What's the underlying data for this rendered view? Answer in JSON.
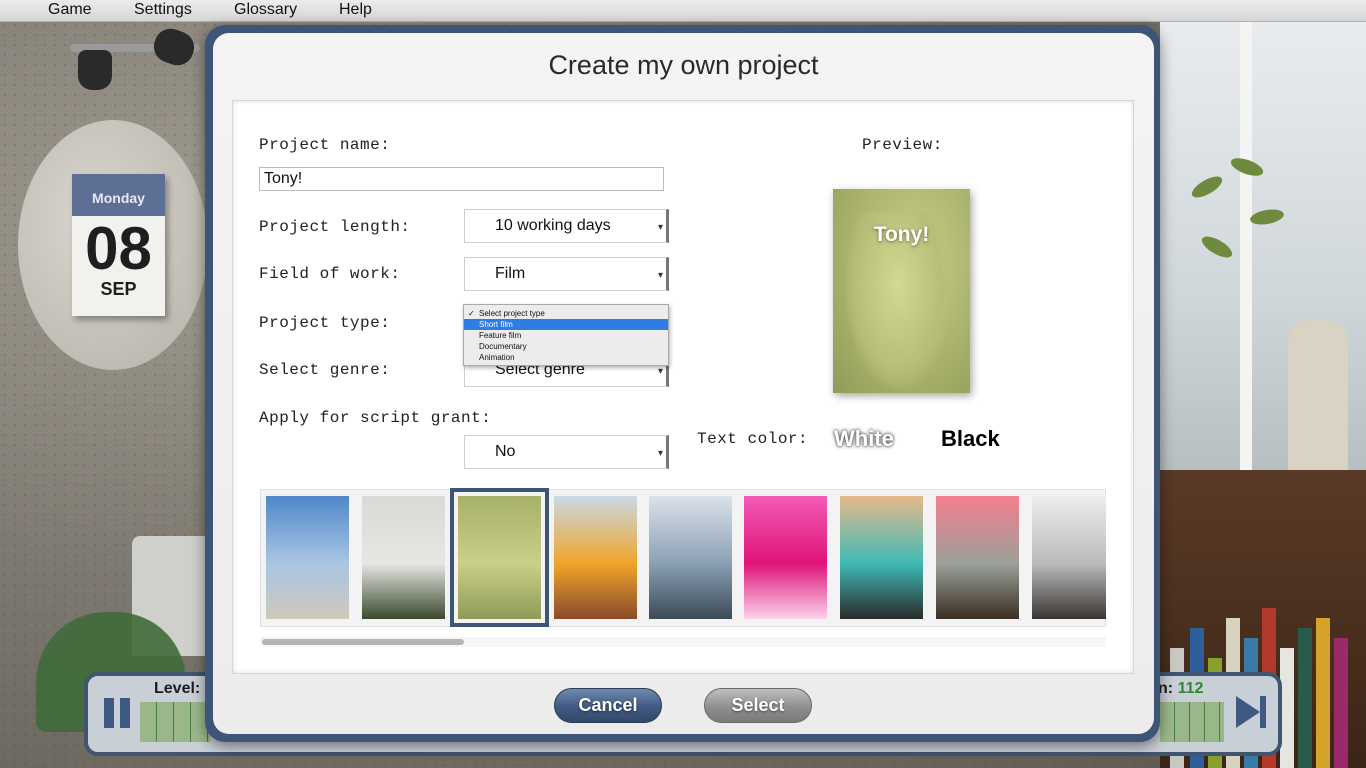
{
  "menu": {
    "items": [
      "Game",
      "Settings",
      "Glossary",
      "Help"
    ]
  },
  "calendar": {
    "weekday": "Monday",
    "day": "08",
    "month": "SEP"
  },
  "gamebar": {
    "level_label": "Level:",
    "money_label_suffix": "n:",
    "money_value": "112"
  },
  "dialog": {
    "title": "Create my own project",
    "project_name": {
      "label": "Project name:",
      "value": "Tony!"
    },
    "project_length": {
      "label": "Project length:",
      "value": "10 working days"
    },
    "field_of_work": {
      "label": "Field of work:",
      "value": "Film"
    },
    "project_type": {
      "label": "Project type:",
      "options": [
        "Select project type",
        "Short film",
        "Feature film",
        "Documentary",
        "Animation"
      ],
      "checked_index": 0,
      "highlighted_index": 1
    },
    "genre": {
      "label": "Select genre:",
      "value": "Select genre"
    },
    "script_grant": {
      "label": "Apply for script grant:",
      "value": "No"
    },
    "preview": {
      "label": "Preview:",
      "card_title": "Tony!"
    },
    "text_color": {
      "label": "Text color:",
      "white": "White",
      "black": "Black"
    },
    "thumbnails": [
      {
        "name": "pier-sea",
        "colors": [
          "#4f87c9",
          "#a9c6e3",
          "#cfc8bb"
        ]
      },
      {
        "name": "green-plant",
        "colors": [
          "#d9d9d6",
          "#e6e6e3",
          "#3a4a2c"
        ]
      },
      {
        "name": "portrait-man",
        "colors": [
          "#a8b16a",
          "#c9cf86",
          "#8f9b58"
        ]
      },
      {
        "name": "fruits-plate",
        "colors": [
          "#c9d9e6",
          "#f0a52a",
          "#8a4a2a"
        ]
      },
      {
        "name": "sunset-sea",
        "colors": [
          "#dbe2ea",
          "#8aa0b4",
          "#3b4a57"
        ]
      },
      {
        "name": "pink-flower",
        "colors": [
          "#f25bb5",
          "#e0147a",
          "#fbd3ea"
        ]
      },
      {
        "name": "wine-glass",
        "colors": [
          "#e6b98a",
          "#3fb9b5",
          "#2a2a2a"
        ]
      },
      {
        "name": "pink-leaf",
        "colors": [
          "#f47f8f",
          "#9aa099",
          "#3a2e22"
        ]
      },
      {
        "name": "sunglasses",
        "colors": [
          "#eeeeee",
          "#bbbbbb",
          "#3a3533"
        ]
      }
    ],
    "buttons": {
      "cancel": "Cancel",
      "select": "Select"
    }
  },
  "colors": {
    "dialog_frame": "#3f5577",
    "highlight": "#2f7de1",
    "cancel_button": "#3f5a82",
    "select_button": "#8f8f8f"
  }
}
